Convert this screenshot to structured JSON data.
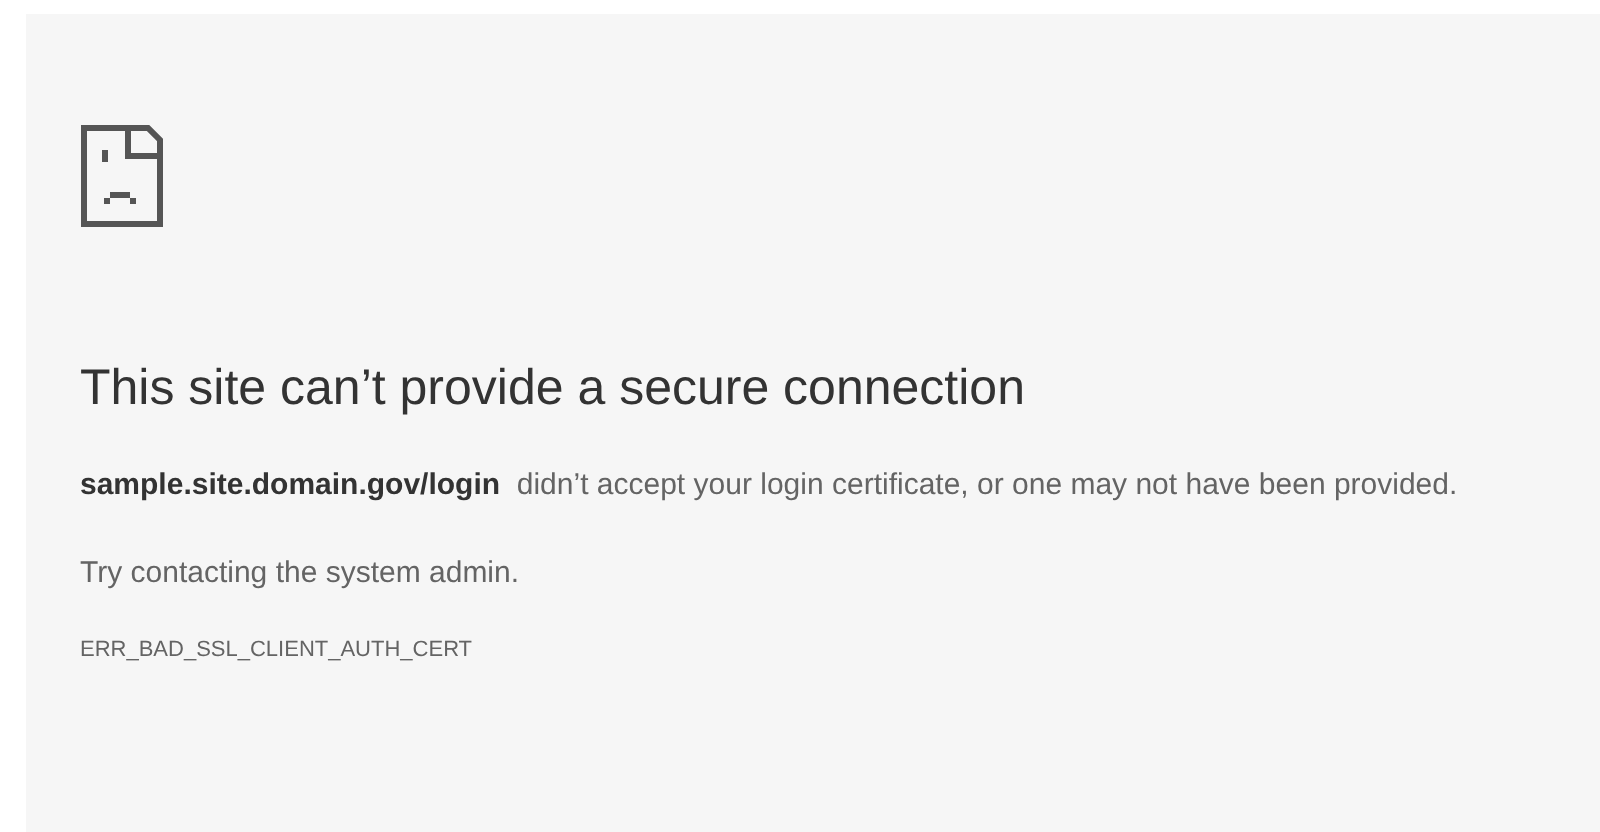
{
  "heading": "This site can’t provide a secure connection",
  "message": "**sample.site.domain.gov/login**  didn’t accept your login certificate, or one may not have been provided.",
  "suggestion": "Try contacting the system admin.",
  "error_code": "ERR_BAD_SSL_CLIENT_AUTH_CERT"
}
